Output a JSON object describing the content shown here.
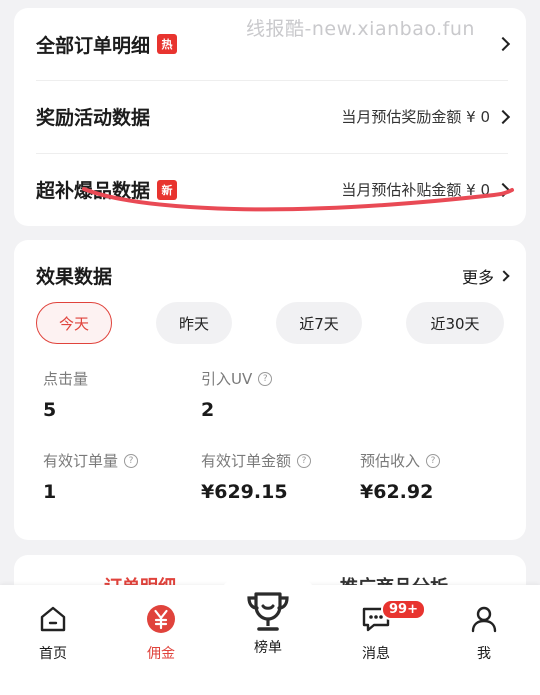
{
  "watermark": "线报酷-new.xianbao.fun",
  "rows": [
    {
      "title": "全部订单明细",
      "tag": "热",
      "right": ""
    },
    {
      "title": "奖励活动数据",
      "tag": "",
      "right": "当月预估奖励金额 ¥ 0"
    },
    {
      "title": "超补爆品数据",
      "tag": "新",
      "right": "当月预估补贴金额 ¥ 0"
    }
  ],
  "effect": {
    "title": "效果数据",
    "more": "更多",
    "pills": [
      "今天",
      "昨天",
      "近7天",
      "近30天"
    ],
    "active_pill": "今天",
    "metrics": [
      {
        "label": "点击量",
        "value": "5",
        "help": false
      },
      {
        "label": "引入UV",
        "value": "2",
        "help": true
      },
      {
        "label": "有效订单量",
        "value": "1",
        "help": true
      },
      {
        "label": "有效订单金额",
        "value": "¥629.15",
        "help": true
      },
      {
        "label": "预估收入",
        "value": "¥62.92",
        "help": true
      }
    ]
  },
  "peek": {
    "left": "订单明细",
    "right": "推广商品分析"
  },
  "tabs": [
    {
      "label": "首页",
      "icon": "home-icon"
    },
    {
      "label": "佣金",
      "icon": "yen-coin-icon"
    },
    {
      "label": "榜单",
      "icon": "trophy-icon"
    },
    {
      "label": "消息",
      "icon": "message-icon",
      "badge": "99+"
    },
    {
      "label": "我",
      "icon": "user-icon"
    }
  ],
  "active_tab": "佣金",
  "colors": {
    "accent": "#e0433c",
    "tag": "#e8342f",
    "background": "#f2f2f4"
  }
}
